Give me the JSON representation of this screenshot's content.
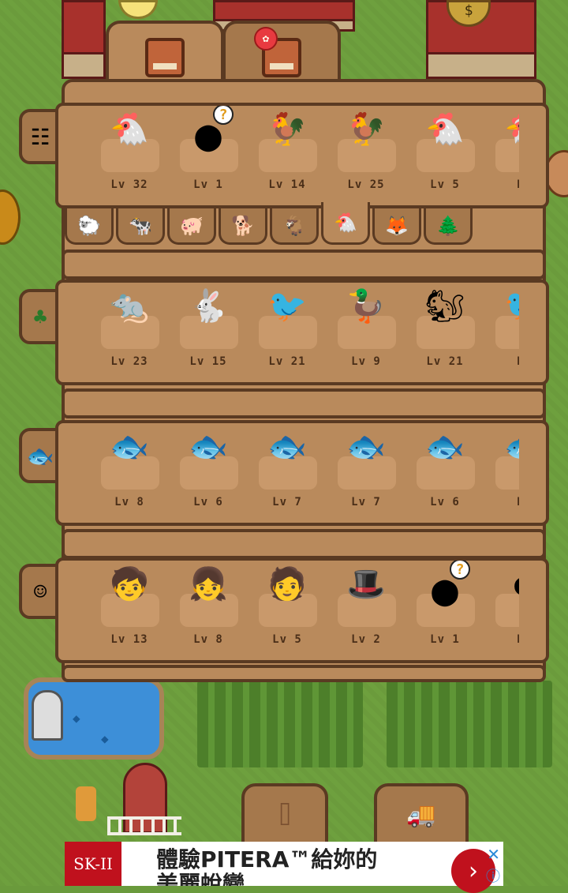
{
  "tabs": [
    {
      "icon": "book-icon",
      "active": true
    },
    {
      "icon": "book-icon",
      "active": false,
      "badge": "✿"
    }
  ],
  "rows": [
    {
      "side_icon": "fence-icon",
      "side_glyph": "☷",
      "items": [
        {
          "name": "chicken",
          "glyph": "🐔",
          "lv": "Lv 32"
        },
        {
          "name": "unknown",
          "glyph": "●",
          "lv": "Lv 1",
          "unknown": true
        },
        {
          "name": "brown-chicken",
          "glyph": "🐓",
          "lv": "Lv 14"
        },
        {
          "name": "black-chicken",
          "glyph": "🐓",
          "lv": "Lv 25"
        },
        {
          "name": "hen",
          "glyph": "🐔",
          "lv": "Lv 5"
        },
        {
          "name": "partial",
          "glyph": "🐔",
          "lv": "Lv"
        }
      ]
    },
    {
      "side_icon": "bush-icon",
      "side_glyph": "♣",
      "items": [
        {
          "name": "opossum",
          "glyph": "🐀",
          "lv": "Lv 23"
        },
        {
          "name": "rabbit",
          "glyph": "🐇",
          "lv": "Lv 15"
        },
        {
          "name": "woodpecker",
          "glyph": "🐦",
          "lv": "Lv 21"
        },
        {
          "name": "duck",
          "glyph": "🦆",
          "lv": "Lv 9"
        },
        {
          "name": "squirrel",
          "glyph": "🐿",
          "lv": "Lv 21"
        },
        {
          "name": "partial",
          "glyph": "🐦",
          "lv": "Lv"
        }
      ]
    },
    {
      "side_icon": "fish-icon",
      "side_glyph": "🐟",
      "items": [
        {
          "name": "fish-1",
          "glyph": "🐟",
          "lv": "Lv 8"
        },
        {
          "name": "fish-2",
          "glyph": "🐟",
          "lv": "Lv 6"
        },
        {
          "name": "fish-3",
          "glyph": "🐟",
          "lv": "Lv 7"
        },
        {
          "name": "fish-4",
          "glyph": "🐟",
          "lv": "Lv 7"
        },
        {
          "name": "fish-5",
          "glyph": "🐟",
          "lv": "Lv 6"
        },
        {
          "name": "partial",
          "glyph": "🐟",
          "lv": "Lv"
        }
      ]
    },
    {
      "side_icon": "face-icon",
      "side_glyph": "☺",
      "items": [
        {
          "name": "boy",
          "glyph": "🧒",
          "lv": "Lv 13"
        },
        {
          "name": "blonde-girl",
          "glyph": "👧",
          "lv": "Lv 8"
        },
        {
          "name": "orange-hair",
          "glyph": "🧑",
          "lv": "Lv 5"
        },
        {
          "name": "top-hat-man",
          "glyph": "🎩",
          "lv": "Lv 2"
        },
        {
          "name": "unknown",
          "glyph": "●",
          "lv": "Lv 1",
          "unknown": true
        },
        {
          "name": "partial",
          "glyph": "●",
          "lv": "Lv"
        }
      ]
    }
  ],
  "categories": [
    {
      "icon": "sheep-icon",
      "glyph": "🐑"
    },
    {
      "icon": "cow-icon",
      "glyph": "🐄"
    },
    {
      "icon": "pig-icon",
      "glyph": "🐖"
    },
    {
      "icon": "dog-icon",
      "glyph": "🐕"
    },
    {
      "icon": "goat-icon",
      "glyph": "🐐"
    },
    {
      "icon": "chicken-icon",
      "glyph": "🐔",
      "active": true
    },
    {
      "icon": "fox-icon",
      "glyph": "🦊"
    },
    {
      "icon": "tree-icon",
      "glyph": "🌲"
    }
  ],
  "bottom_nav": [
    {
      "icon": "camera-icon",
      "glyph": "⌷"
    },
    {
      "icon": "truck-icon",
      "glyph": "🚚"
    }
  ],
  "ad": {
    "logo": "SK-II",
    "text": "體驗PITERA™給妳的",
    "text2": "美麗蛻變",
    "go": "›",
    "close": "✕",
    "info": "ⓘ"
  },
  "unknown_mark": "?"
}
